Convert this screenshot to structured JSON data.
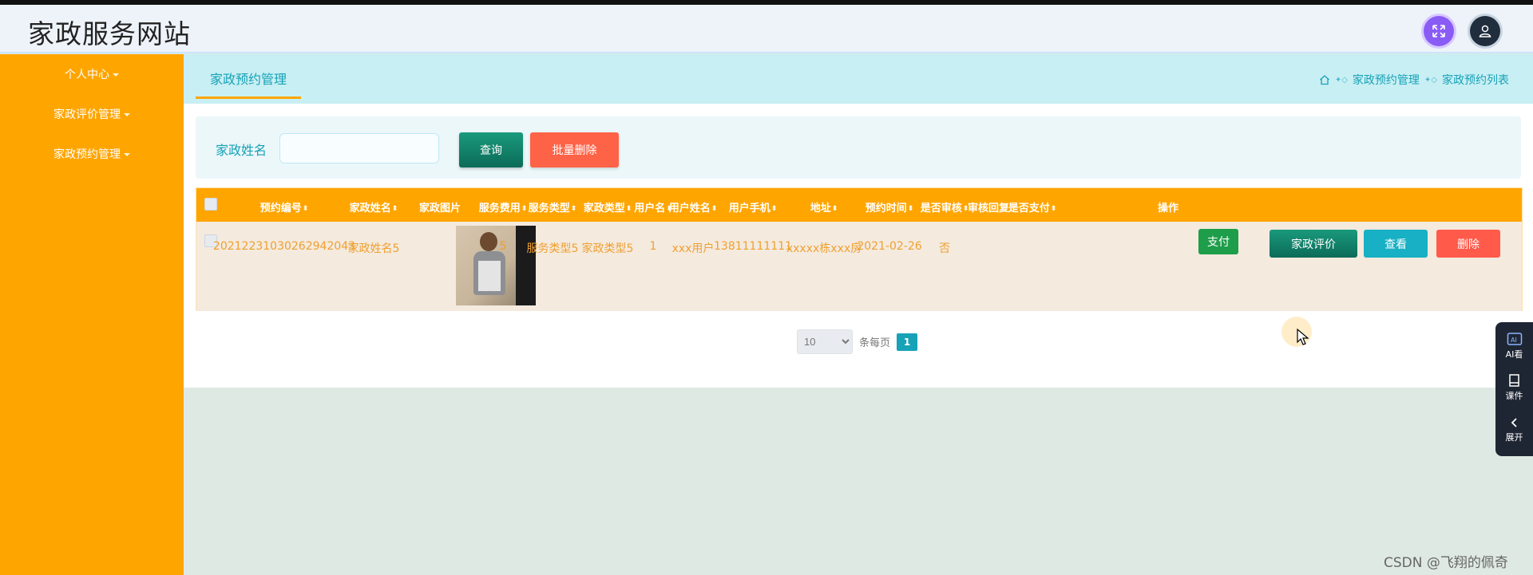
{
  "app": {
    "title": "家政服务网站"
  },
  "header": {
    "expand_icon": "expand-arrows-icon",
    "user_icon": "user-icon"
  },
  "sidebar": {
    "items": [
      {
        "label": "个人中心"
      },
      {
        "label": "家政评价管理"
      },
      {
        "label": "家政预约管理"
      }
    ]
  },
  "tabs": {
    "active": "家政预约管理"
  },
  "breadcrumb": {
    "items": [
      "家政预约管理",
      "家政预约列表"
    ]
  },
  "search": {
    "label": "家政姓名",
    "value": "",
    "placeholder": "",
    "query_label": "查询",
    "batch_delete_label": "批量删除"
  },
  "table": {
    "columns": [
      "预约编号",
      "家政姓名",
      "家政图片",
      "服务费用",
      "服务类型",
      "家政类型",
      "用户名",
      "用户姓名",
      "用户手机",
      "地址",
      "预约时间",
      "是否审核",
      "审核回复",
      "是否支付",
      "操作"
    ],
    "rows": [
      {
        "id": "20212231030262942043",
        "name": "家政姓名5",
        "fee": "5",
        "service_type": "服务类型5",
        "housekeeping_type": "家政类型5",
        "username": "1",
        "user_fullname": "xxx用户",
        "phone": "13811111111",
        "address": "xxxxx栋xxx房",
        "date": "2021-02-26",
        "audited": "否",
        "audit_reply": "",
        "pay_label": "支付",
        "eval_label": "家政评价",
        "view_label": "查看",
        "delete_label": "删除"
      }
    ]
  },
  "pagination": {
    "page_size": "10",
    "per_page_text": "条每页",
    "current_page": "1"
  },
  "float_panel": {
    "items": [
      {
        "label": "AI看"
      },
      {
        "label": "课件"
      },
      {
        "label": "展开"
      }
    ]
  },
  "watermark": "CSDN @飞翔的佩奇",
  "colors": {
    "primary": "#ffa500",
    "teal": "#17a2b8",
    "danger": "#ff6347",
    "success": "#1e9e4a"
  }
}
